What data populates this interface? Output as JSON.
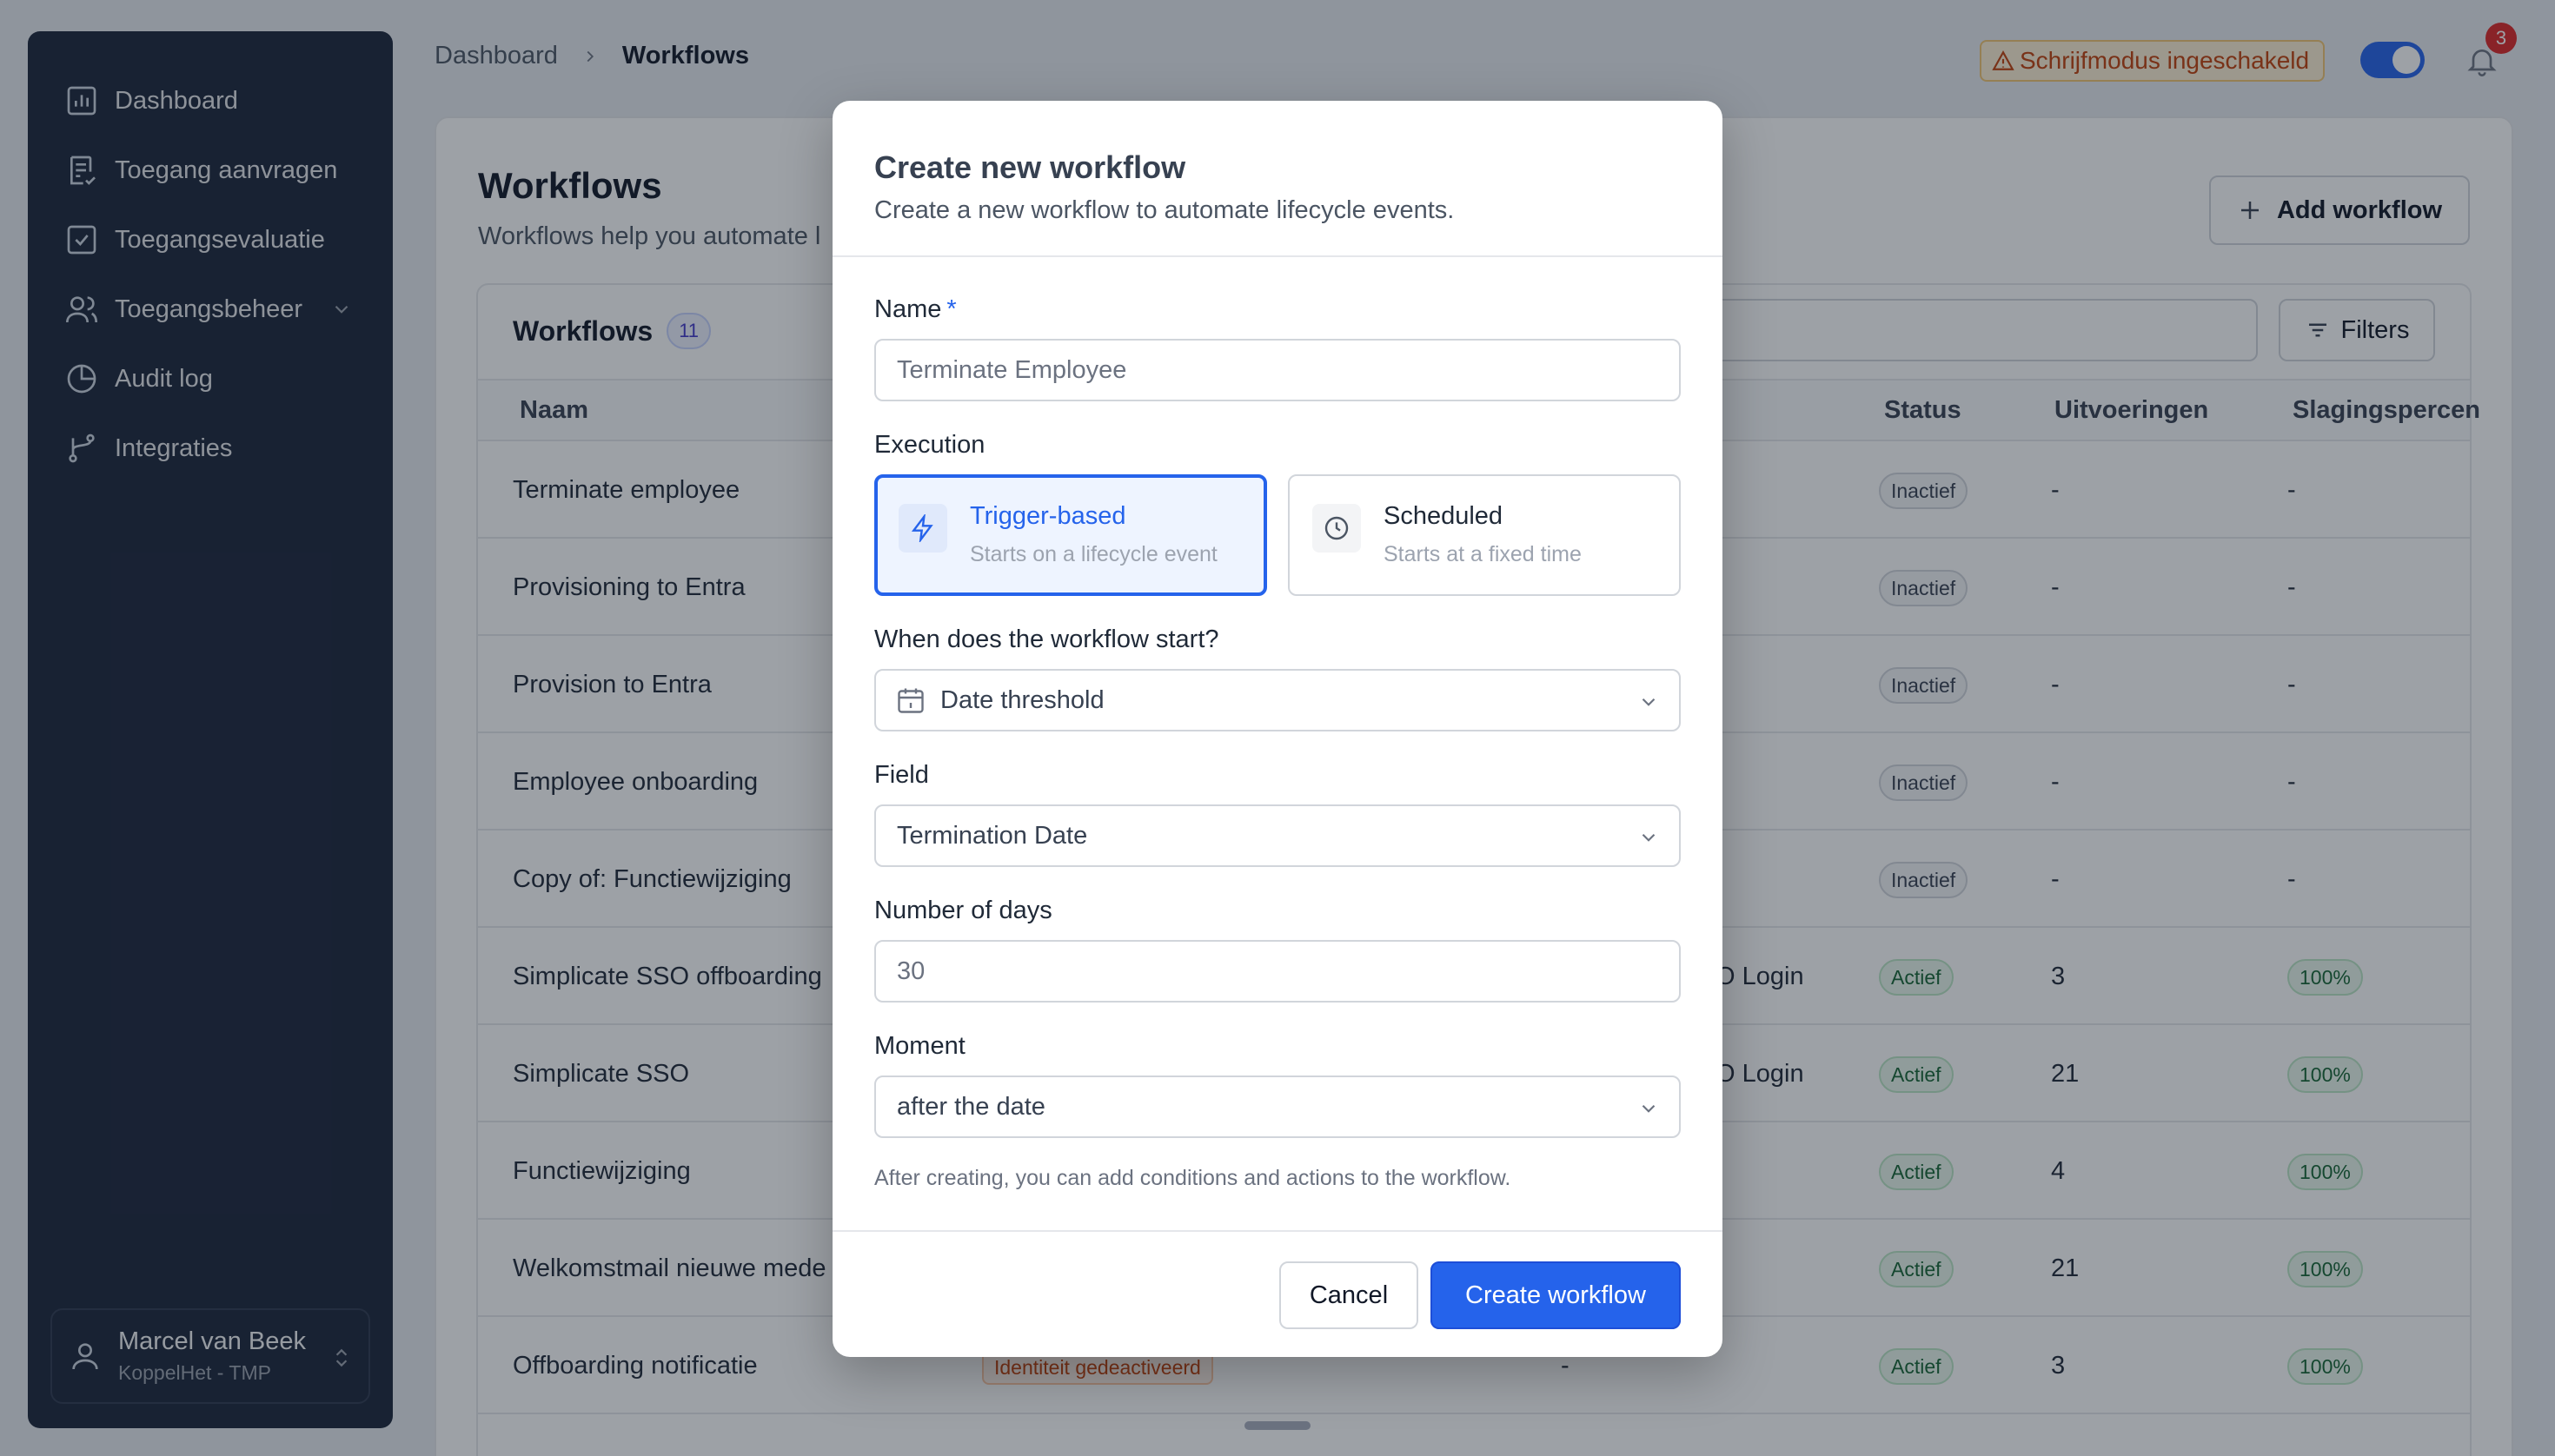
{
  "sidebar": {
    "items": [
      {
        "label": "Dashboard",
        "icon": "chart-icon"
      },
      {
        "label": "Toegang aanvragen",
        "icon": "request-icon"
      },
      {
        "label": "Toegangsevaluatie",
        "icon": "check-square-icon"
      },
      {
        "label": "Toegangsbeheer",
        "icon": "users-icon"
      },
      {
        "label": "Audit log",
        "icon": "pie-icon"
      },
      {
        "label": "Integraties",
        "icon": "branch-icon"
      }
    ],
    "user": {
      "name": "Marcel van Beek",
      "org": "KoppelHet - TMP"
    }
  },
  "header": {
    "breadcrumb": [
      "Dashboard",
      "Workflows"
    ],
    "write_mode": "Schrijfmodus ingeschakeld",
    "notifications": "3"
  },
  "page": {
    "title": "Workflows",
    "subtitle": "Workflows help you automate l",
    "add_button": "Add workflow"
  },
  "table": {
    "title": "Workflows",
    "count": "11",
    "filters": "Filters",
    "columns": {
      "name": "Naam",
      "status": "Status",
      "runs": "Uitvoeringen",
      "rate": "Slagingspercen"
    },
    "rows": [
      {
        "name": "Terminate employee",
        "trigger": "",
        "status": "Inactief",
        "runs": "-",
        "rate": "-"
      },
      {
        "name": "Provisioning to Entra",
        "trigger": "",
        "status": "Inactief",
        "runs": "-",
        "rate": "-"
      },
      {
        "name": "Provision to Entra",
        "trigger": "",
        "status": "Inactief",
        "runs": "-",
        "rate": "-"
      },
      {
        "name": "Employee onboarding",
        "trigger": "",
        "status": "Inactief",
        "runs": "-",
        "rate": "-"
      },
      {
        "name": "Copy of: Functiewijziging",
        "trigger": "",
        "status": "Inactief",
        "runs": "-",
        "rate": "-"
      },
      {
        "name": "Simplicate SSO offboarding",
        "trigger": "O Login",
        "status": "Actief",
        "runs": "3",
        "rate": "100%"
      },
      {
        "name": "Simplicate SSO",
        "trigger": "O Login",
        "status": "Actief",
        "runs": "21",
        "rate": "100%"
      },
      {
        "name": "Functiewijziging",
        "trigger": "",
        "status": "Actief",
        "runs": "4",
        "rate": "100%"
      },
      {
        "name": "Welkomstmail nieuwe mede",
        "trigger": "",
        "status": "Actief",
        "runs": "21",
        "rate": "100%"
      },
      {
        "name": "Offboarding notificatie",
        "trigger": "-",
        "tag": "Identiteit gedeactiveerd",
        "status": "Actief",
        "runs": "3",
        "rate": "100%"
      }
    ]
  },
  "modal": {
    "title": "Create new workflow",
    "subtitle": "Create a new workflow to automate lifecycle events.",
    "name_label": "Name",
    "name_required": "*",
    "name_placeholder": "Terminate Employee",
    "execution_label": "Execution",
    "trigger_title": "Trigger-based",
    "trigger_sub": "Starts on a lifecycle event",
    "scheduled_title": "Scheduled",
    "scheduled_sub": "Starts at a fixed time",
    "start_label": "When does the workflow start?",
    "start_value": "Date threshold",
    "field_label": "Field",
    "field_value": "Termination Date",
    "days_label": "Number of days",
    "days_placeholder": "30",
    "moment_label": "Moment",
    "moment_value": "after the date",
    "hint": "After creating, you can add conditions and actions to the workflow.",
    "cancel": "Cancel",
    "create": "Create workflow"
  }
}
